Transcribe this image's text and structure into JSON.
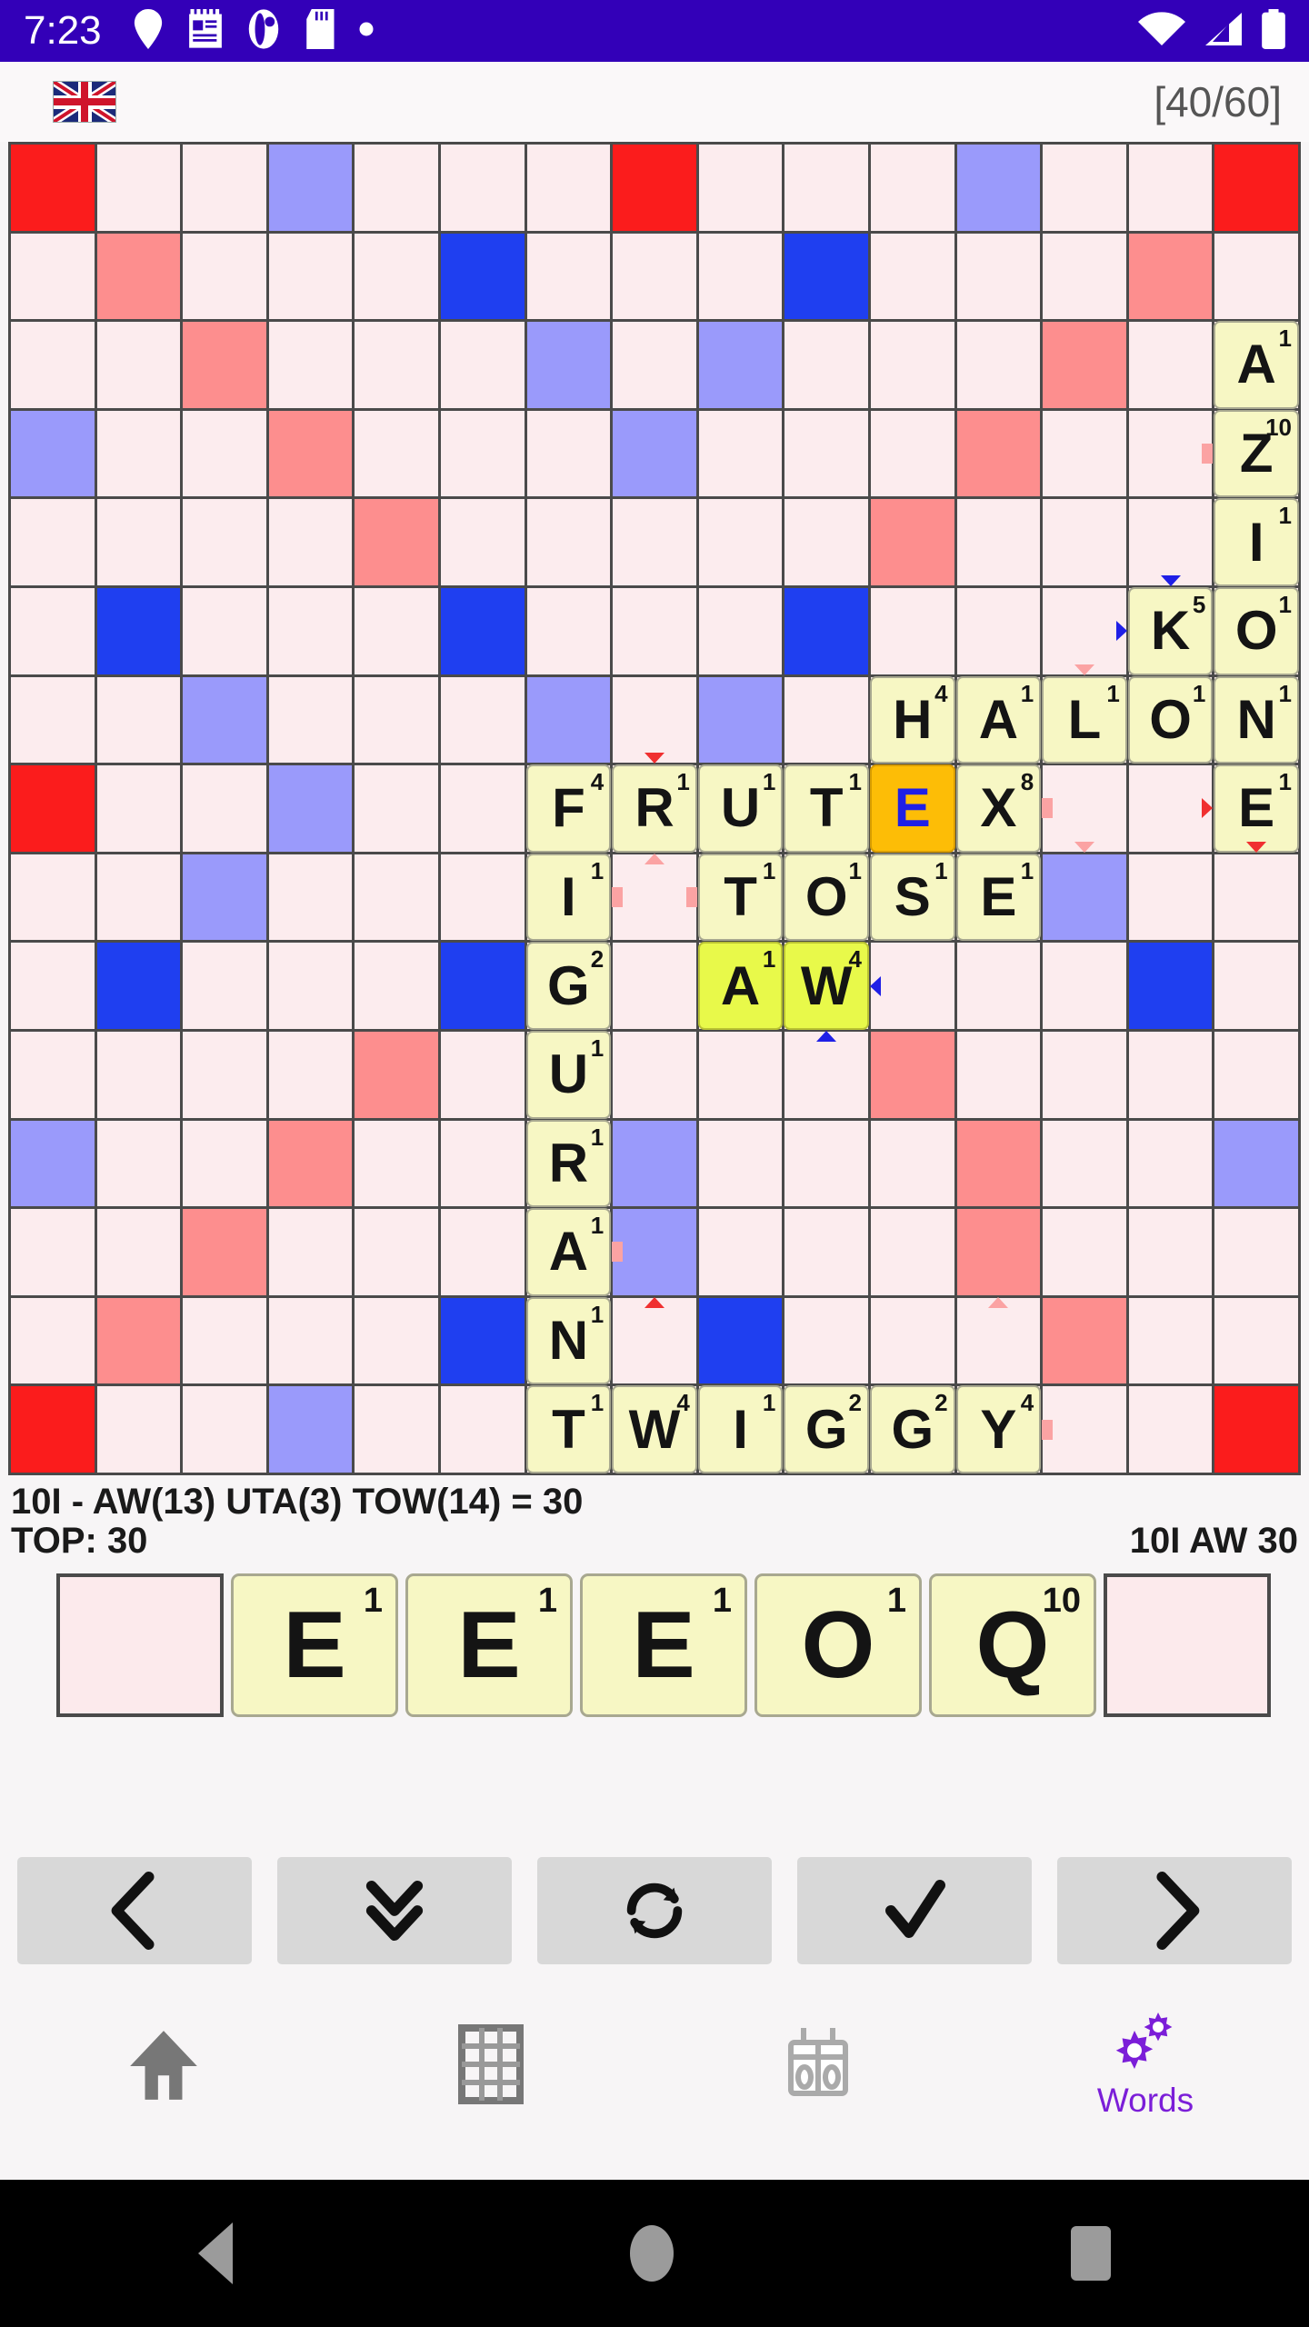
{
  "status_bar": {
    "time": "7:23",
    "left_icons": [
      "location-pin-icon",
      "notes-icon",
      "app-icon",
      "sd-card-icon",
      "dot-icon"
    ],
    "right_icons": [
      "wifi-icon",
      "cell-signal-icon",
      "battery-icon"
    ]
  },
  "header": {
    "flag_icon": "uk-flag-icon",
    "counter": "[40/60]"
  },
  "board": {
    "rows": 15,
    "cols": 15,
    "premium_legend": {
      "tw": "#fb1c1c",
      "dw": "#fd8e8e",
      "tl": "#1f3ff0",
      "dl": "#9a9afb",
      "normal": "#fcecee"
    },
    "premium": [
      [
        "tw",
        "",
        "",
        "dl",
        "",
        "",
        "",
        "tw",
        "",
        "",
        "",
        "dl",
        "",
        "",
        "tw"
      ],
      [
        "",
        "dw",
        "",
        "",
        "",
        "tl",
        "",
        "",
        "",
        "tl",
        "",
        "",
        "",
        "dw",
        ""
      ],
      [
        "",
        "",
        "dw",
        "",
        "",
        "",
        "dl",
        "",
        "dl",
        "",
        "",
        "",
        "dw",
        "",
        ""
      ],
      [
        "dl",
        "",
        "",
        "dw",
        "",
        "",
        "",
        "dl",
        "",
        "",
        "",
        "dw",
        "",
        "",
        ""
      ],
      [
        "",
        "",
        "",
        "",
        "dw",
        "",
        "",
        "",
        "",
        "",
        "dw",
        "",
        "",
        "",
        ""
      ],
      [
        "",
        "tl",
        "",
        "",
        "",
        "tl",
        "",
        "",
        "",
        "tl",
        "",
        "",
        "",
        "",
        ""
      ],
      [
        "",
        "",
        "dl",
        "",
        "",
        "",
        "dl",
        "",
        "dl",
        "",
        "",
        "",
        "",
        "",
        ""
      ],
      [
        "tw",
        "",
        "",
        "dl",
        "",
        "",
        "",
        "",
        "",
        "",
        "",
        "",
        "",
        "",
        ""
      ],
      [
        "",
        "",
        "dl",
        "",
        "",
        "",
        "",
        "",
        "",
        "",
        "",
        "",
        "dl",
        "",
        ""
      ],
      [
        "",
        "tl",
        "",
        "",
        "",
        "tl",
        "",
        "",
        "",
        "",
        "",
        "",
        "",
        "tl",
        ""
      ],
      [
        "",
        "",
        "",
        "",
        "dw",
        "",
        "",
        "",
        "",
        "",
        "dw",
        "",
        "",
        "",
        ""
      ],
      [
        "dl",
        "",
        "",
        "dw",
        "",
        "",
        "",
        "dl",
        "",
        "",
        "",
        "dw",
        "",
        "",
        "dl"
      ],
      [
        "",
        "",
        "dw",
        "",
        "",
        "",
        "",
        "dl",
        "",
        "",
        "",
        "dw",
        "",
        "",
        ""
      ],
      [
        "",
        "dw",
        "",
        "",
        "",
        "tl",
        "",
        "",
        "tl",
        "",
        "",
        "",
        "dw",
        "",
        ""
      ],
      [
        "tw",
        "",
        "",
        "dl",
        "",
        "",
        "",
        "",
        "",
        "",
        "",
        "",
        "",
        "",
        "tw"
      ]
    ],
    "tiles": [
      {
        "r": 2,
        "c": 14,
        "letter": "A",
        "value": "1"
      },
      {
        "r": 3,
        "c": 14,
        "letter": "Z",
        "value": "10"
      },
      {
        "r": 4,
        "c": 14,
        "letter": "I",
        "value": "1"
      },
      {
        "r": 5,
        "c": 13,
        "letter": "K",
        "value": "5"
      },
      {
        "r": 5,
        "c": 14,
        "letter": "O",
        "value": "1"
      },
      {
        "r": 6,
        "c": 10,
        "letter": "H",
        "value": "4"
      },
      {
        "r": 6,
        "c": 11,
        "letter": "A",
        "value": "1"
      },
      {
        "r": 6,
        "c": 12,
        "letter": "L",
        "value": "1"
      },
      {
        "r": 6,
        "c": 13,
        "letter": "O",
        "value": "1"
      },
      {
        "r": 6,
        "c": 14,
        "letter": "N",
        "value": "1"
      },
      {
        "r": 7,
        "c": 6,
        "letter": "F",
        "value": "4"
      },
      {
        "r": 7,
        "c": 7,
        "letter": "R",
        "value": "1"
      },
      {
        "r": 7,
        "c": 8,
        "letter": "U",
        "value": "1"
      },
      {
        "r": 7,
        "c": 9,
        "letter": "T",
        "value": "1"
      },
      {
        "r": 7,
        "c": 10,
        "letter": "E",
        "value": "",
        "state": "selected"
      },
      {
        "r": 7,
        "c": 11,
        "letter": "X",
        "value": "8"
      },
      {
        "r": 7,
        "c": 14,
        "letter": "E",
        "value": "1"
      },
      {
        "r": 8,
        "c": 6,
        "letter": "I",
        "value": "1"
      },
      {
        "r": 8,
        "c": 8,
        "letter": "T",
        "value": "1"
      },
      {
        "r": 8,
        "c": 9,
        "letter": "O",
        "value": "1"
      },
      {
        "r": 8,
        "c": 10,
        "letter": "S",
        "value": "1"
      },
      {
        "r": 8,
        "c": 11,
        "letter": "E",
        "value": "1"
      },
      {
        "r": 9,
        "c": 6,
        "letter": "G",
        "value": "2"
      },
      {
        "r": 9,
        "c": 8,
        "letter": "A",
        "value": "1",
        "state": "new"
      },
      {
        "r": 9,
        "c": 9,
        "letter": "W",
        "value": "4",
        "state": "new"
      },
      {
        "r": 10,
        "c": 6,
        "letter": "U",
        "value": "1"
      },
      {
        "r": 11,
        "c": 6,
        "letter": "R",
        "value": "1"
      },
      {
        "r": 12,
        "c": 6,
        "letter": "A",
        "value": "1"
      },
      {
        "r": 13,
        "c": 6,
        "letter": "N",
        "value": "1"
      },
      {
        "r": 14,
        "c": 6,
        "letter": "T",
        "value": "1"
      },
      {
        "r": 14,
        "c": 7,
        "letter": "W",
        "value": "4"
      },
      {
        "r": 14,
        "c": 8,
        "letter": "I",
        "value": "1"
      },
      {
        "r": 14,
        "c": 9,
        "letter": "G",
        "value": "2"
      },
      {
        "r": 14,
        "c": 10,
        "letter": "G",
        "value": "2"
      },
      {
        "r": 14,
        "c": 11,
        "letter": "Y",
        "value": "4"
      }
    ],
    "markers": [
      {
        "r": 3,
        "c": 13,
        "dir": "right",
        "color": "p"
      },
      {
        "r": 4,
        "c": 13,
        "dir": "down",
        "color": "b"
      },
      {
        "r": 5,
        "c": 12,
        "dir": "right",
        "color": "b"
      },
      {
        "r": 5,
        "c": 12,
        "dir": "down",
        "color": "p"
      },
      {
        "r": 6,
        "c": 7,
        "dir": "down",
        "color": "r"
      },
      {
        "r": 7,
        "c": 12,
        "dir": "down",
        "color": "p"
      },
      {
        "r": 7,
        "c": 12,
        "dir": "left",
        "color": "p"
      },
      {
        "r": 7,
        "c": 13,
        "dir": "right",
        "color": "r"
      },
      {
        "r": 7,
        "c": 14,
        "dir": "down",
        "color": "r"
      },
      {
        "r": 8,
        "c": 7,
        "dir": "left",
        "color": "p"
      },
      {
        "r": 8,
        "c": 7,
        "dir": "right",
        "color": "p"
      },
      {
        "r": 8,
        "c": 7,
        "dir": "up",
        "color": "p"
      },
      {
        "r": 9,
        "c": 10,
        "dir": "left",
        "color": "b"
      },
      {
        "r": 10,
        "c": 9,
        "dir": "up",
        "color": "b"
      },
      {
        "r": 12,
        "c": 7,
        "dir": "left",
        "color": "p"
      },
      {
        "r": 13,
        "c": 7,
        "dir": "up",
        "color": "r"
      },
      {
        "r": 13,
        "c": 11,
        "dir": "up",
        "color": "p"
      },
      {
        "r": 14,
        "c": 12,
        "dir": "left",
        "color": "p"
      }
    ]
  },
  "score": {
    "breakdown": "10I - AW(13) UTA(3) TOW(14)  = 30",
    "top_label": "TOP: 30",
    "best_move": "10I AW 30"
  },
  "rack": {
    "slots": [
      {
        "type": "empty"
      },
      {
        "type": "tile",
        "letter": "E",
        "value": "1"
      },
      {
        "type": "tile",
        "letter": "E",
        "value": "1"
      },
      {
        "type": "tile",
        "letter": "E",
        "value": "1"
      },
      {
        "type": "tile",
        "letter": "O",
        "value": "1"
      },
      {
        "type": "tile",
        "letter": "Q",
        "value": "10"
      },
      {
        "type": "empty"
      }
    ]
  },
  "actions": [
    {
      "name": "previous-button",
      "icon": "chevron-left-icon"
    },
    {
      "name": "drop-down-button",
      "icon": "chevron-double-down-icon"
    },
    {
      "name": "shuffle-button",
      "icon": "refresh-icon"
    },
    {
      "name": "confirm-button",
      "icon": "check-icon"
    },
    {
      "name": "next-button",
      "icon": "chevron-right-icon"
    }
  ],
  "bottom_nav": [
    {
      "name": "nav-home",
      "icon": "home-icon",
      "label": ""
    },
    {
      "name": "nav-board",
      "icon": "grid-icon",
      "label": ""
    },
    {
      "name": "nav-scores",
      "icon": "scoreboard-icon",
      "label": ""
    },
    {
      "name": "nav-words",
      "icon": "gears-icon",
      "label": "Words"
    }
  ],
  "android_nav": {
    "back": "back-triangle-icon",
    "home": "home-circle-icon",
    "recents": "recents-square-icon"
  },
  "colors": {
    "status_bar_bg": "#3300b8",
    "accent": "#7b1ed8",
    "selected_tile": "#fdbd06",
    "new_tile": "#e8f94a"
  }
}
